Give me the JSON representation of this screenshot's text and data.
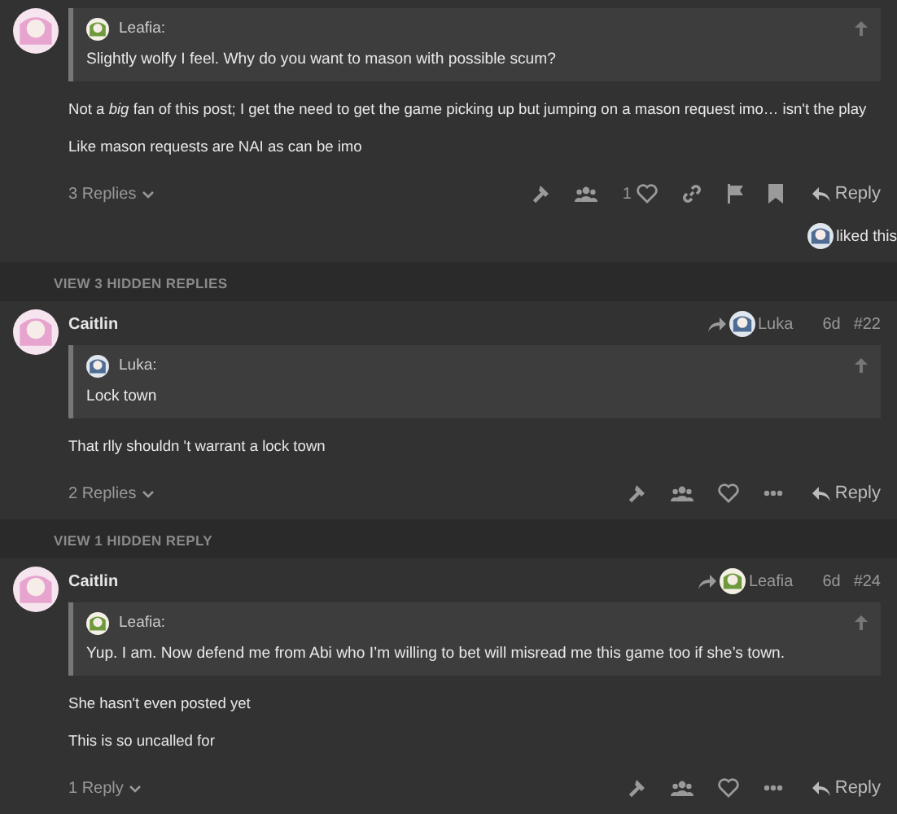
{
  "items": [
    {
      "kind": "post",
      "quote": {
        "author": "Leafia:",
        "text": "Slightly wolfy I feel. Why do you want to mason with possible scum?"
      },
      "paragraphs": [
        "Not a *big* fan of this post; I get the need to get the game picking up but jumping on a mason request imo… isn't the play",
        "Like mason requests are NAI as can be imo"
      ],
      "replies": "3 Replies",
      "actions": [
        {
          "kind": "hammer"
        },
        {
          "kind": "group"
        },
        {
          "kind": "like",
          "count": "1"
        },
        {
          "kind": "link"
        },
        {
          "kind": "flag"
        },
        {
          "kind": "bookmark"
        }
      ],
      "reply": "Reply",
      "liked": "liked this"
    },
    {
      "kind": "hidden",
      "label": "VIEW 3 HIDDEN REPLIES"
    },
    {
      "kind": "post",
      "header": {
        "author": "Caitlin",
        "reply_to": "Luka",
        "date": "6d",
        "number": "#22"
      },
      "quote": {
        "author": "Luka:",
        "text": "Lock town"
      },
      "paragraphs": [
        "That rlly shouldn 't warrant a lock town"
      ],
      "replies": "2 Replies",
      "actions": [
        {
          "kind": "hammer"
        },
        {
          "kind": "group"
        },
        {
          "kind": "like"
        },
        {
          "kind": "more"
        }
      ],
      "reply": "Reply"
    },
    {
      "kind": "hidden",
      "label": "VIEW 1 HIDDEN REPLY"
    },
    {
      "kind": "post",
      "header": {
        "author": "Caitlin",
        "reply_to": "Leafia",
        "date": "6d",
        "number": "#24"
      },
      "quote": {
        "author": "Leafia:",
        "text": "Yup. I am. Now defend me from Abi who I’m willing to bet will misread me this game too if she’s town."
      },
      "paragraphs": [
        "She hasn't even posted yet",
        "This is so uncalled for"
      ],
      "replies": "1 Reply",
      "actions": [
        {
          "kind": "hammer"
        },
        {
          "kind": "group"
        },
        {
          "kind": "like"
        },
        {
          "kind": "more"
        }
      ],
      "reply": "Reply"
    }
  ]
}
